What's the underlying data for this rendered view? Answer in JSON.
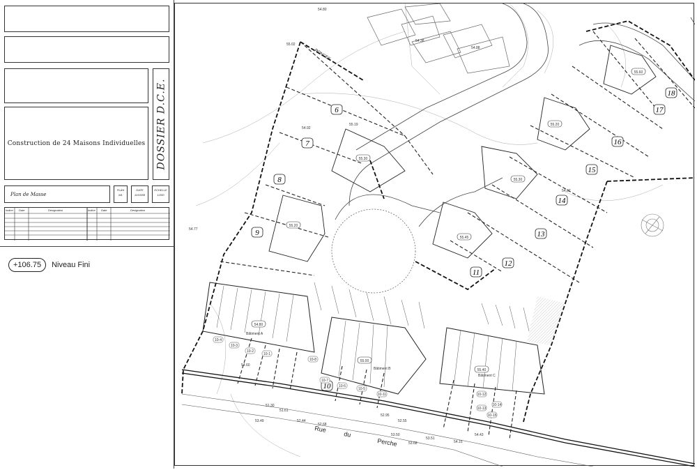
{
  "cartouche": {
    "project_title": "Construction de 24 Maisons Individuelles",
    "dossier": "DOSSIER D.C.E.",
    "sheet_name": "Plan de Masse",
    "plan_label": "PLAN",
    "plan_value": "M1",
    "date_label": "DATE",
    "date_value": "11/03/08",
    "scale_label": "ECHELLE",
    "scale_value": "1/200",
    "rev_headers": [
      "Indice",
      "Date",
      "Designation",
      "Indice",
      "Date",
      "Designation"
    ]
  },
  "legend": {
    "level_value": "+106.75",
    "level_text": "Niveau Fini"
  },
  "plan": {
    "lots": [
      "6",
      "7",
      "8",
      "9",
      "10",
      "11",
      "12",
      "13",
      "14",
      "15",
      "16",
      "17",
      "18"
    ],
    "levels": [
      "55.30",
      "55.20",
      "55.45",
      "55.30",
      "55.20",
      "55.60",
      "54.80",
      "55.00",
      "55.40"
    ],
    "building_labels": [
      "Bâtiment A",
      "Bâtiment B",
      "Bâtiment C"
    ],
    "street": [
      "Rue",
      "du",
      "Perche"
    ],
    "spot_heights": [
      "54.80",
      "54.38",
      "54.88",
      "54.92",
      "54.77",
      "53.51",
      "52.55",
      "53.50",
      "52.95",
      "53.68",
      "54.15",
      "52.44",
      "52.68",
      "51.61",
      "51.30",
      "53.49",
      "54.43",
      "54.60",
      "55.02",
      "55.19",
      "54.87"
    ],
    "parking_tags": [
      "10-4",
      "10-3",
      "10-2",
      "10-1",
      "10-8",
      "10-7",
      "10-6",
      "10-5",
      "10-11",
      "10-12",
      "10-13",
      "10-14",
      "10-15"
    ],
    "ronces": "RONCES"
  }
}
